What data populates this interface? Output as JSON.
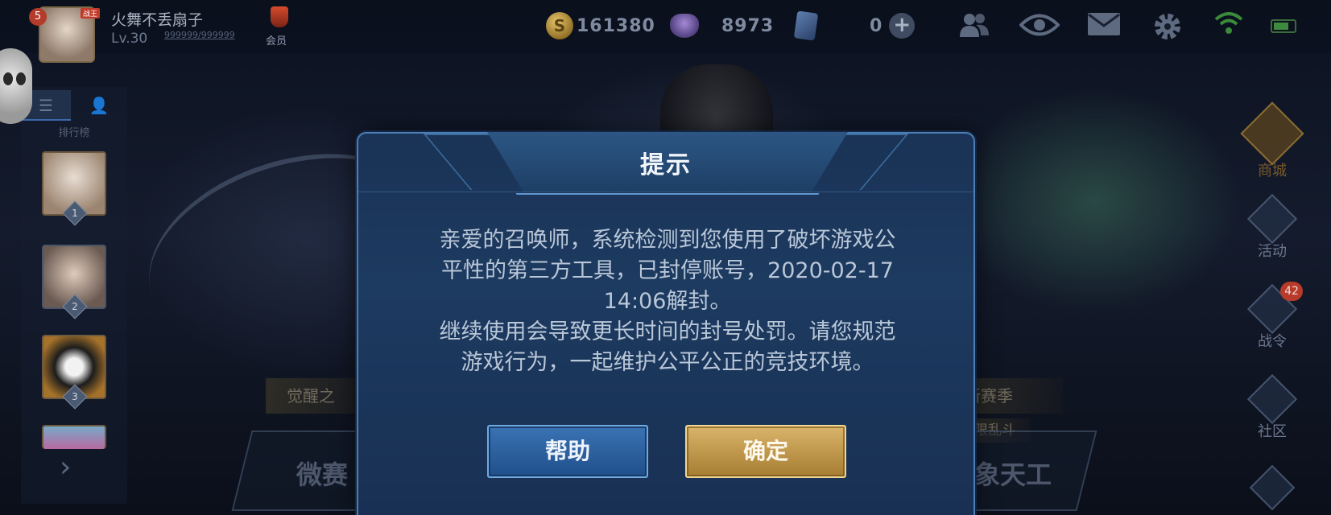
{
  "player": {
    "name": "火舞不丢扇子",
    "level": "Lv.30",
    "exp": "999999/999999",
    "rank_badge": "5",
    "avatar_tag": "战王",
    "vip_label": "会员"
  },
  "currencies": {
    "coins": "161380",
    "coin_symbol": "S",
    "gems": "8973",
    "vouchers": "0"
  },
  "top_icons": [
    "friends-icon",
    "spectate-icon",
    "mail-icon",
    "settings-icon",
    "wifi-icon",
    "battery-icon"
  ],
  "left_panel": {
    "title": "排行榜",
    "ranks": [
      "1",
      "2",
      "3"
    ]
  },
  "right_nav": {
    "items": [
      {
        "label": "商城"
      },
      {
        "label": "活动"
      },
      {
        "label": "战令",
        "badge": "42"
      },
      {
        "label": "社区"
      }
    ]
  },
  "background": {
    "banner_left": "觉醒之",
    "banner_right": "战新赛季",
    "banner_right_sub": "限乱斗",
    "card_left": "微赛",
    "card_right": "象天工"
  },
  "dialog": {
    "title": "提示",
    "message": "亲爱的召唤师，系统检测到您使用了破坏游戏公\n平性的第三方工具，已封停账号，2020-02-17\n14:06解封。\n继续使用会导致更长时间的封号处罚。请您规范\n游戏行为，一起维护公平公正的竞技环境。",
    "help_label": "帮助",
    "ok_label": "确定"
  },
  "colors": {
    "dialog_bg": "#1d3a60",
    "help_button": "#2d63a0",
    "ok_button": "#c49a4e"
  }
}
